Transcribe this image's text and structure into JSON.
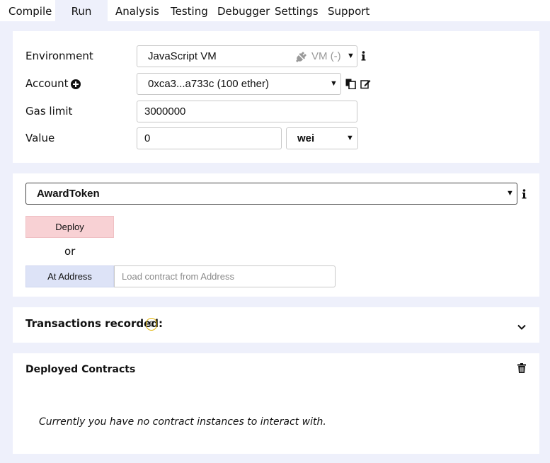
{
  "tabs": [
    "Compile",
    "Run",
    "Analysis",
    "Testing",
    "Debugger",
    "Settings",
    "Support"
  ],
  "environment": {
    "label": "Environment",
    "value": "JavaScript VM",
    "vm_status": "VM (-)"
  },
  "account": {
    "label": "Account",
    "value": "0xca3...a733c (100 ether)"
  },
  "gas_limit": {
    "label": "Gas limit",
    "value": "3000000"
  },
  "value": {
    "label": "Value",
    "amount": "0",
    "unit": "wei"
  },
  "contract": {
    "selected": "AwardToken"
  },
  "deploy": {
    "button": "Deploy",
    "or": "or",
    "at_address_button": "At Address",
    "address_placeholder": "Load contract from Address"
  },
  "transactions": {
    "label": "Transactions recorded:",
    "count": "0"
  },
  "deployed": {
    "title": "Deployed Contracts",
    "empty_message": "Currently you have no contract instances to interact with."
  },
  "colors": {
    "deploy_bg": "#f8d1d4",
    "at_address_bg": "#dde3f7",
    "badge_border": "#e0b100",
    "page_bg": "#eef0fb"
  }
}
